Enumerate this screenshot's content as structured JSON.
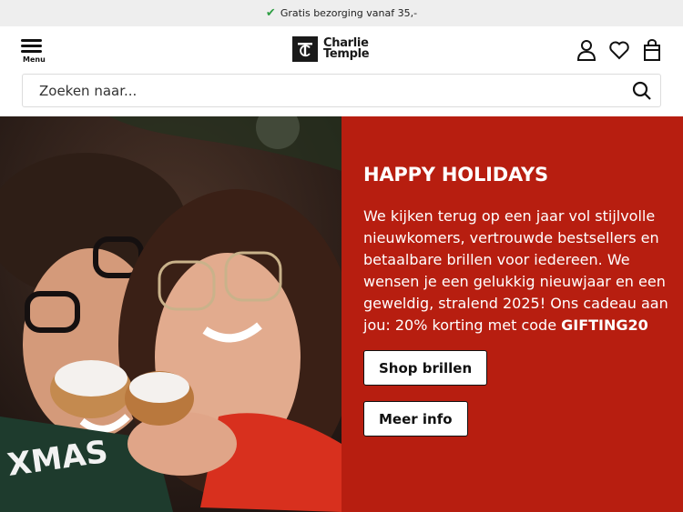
{
  "promo": {
    "text": "Gratis bezorging vanaf 35,-",
    "icon": "check-icon"
  },
  "header": {
    "menu_label": "Menu",
    "logo": {
      "line1": "Charlie",
      "line2": "Temple"
    },
    "icons": [
      "account-icon",
      "heart-icon",
      "bag-icon"
    ]
  },
  "search": {
    "placeholder": "Zoeken naar...",
    "value": ""
  },
  "hero": {
    "title": "HAPPY HOLIDAYS",
    "body": "We kijken terug op een jaar vol stijlvolle nieuwkomers, vertrouwde bestsellers en betaalbare brillen voor iedereen. We wensen je een gelukkig nieuwjaar en een geweldig, stralend 2025! Ons cadeau aan jou: 20% korting met code ",
    "code": "GIFTING20",
    "buttons": {
      "shop": "Shop brillen",
      "info": "Meer info"
    }
  },
  "colors": {
    "accent": "#b71e10",
    "promo_bg": "#eeeeee",
    "check": "#2f9e44"
  }
}
